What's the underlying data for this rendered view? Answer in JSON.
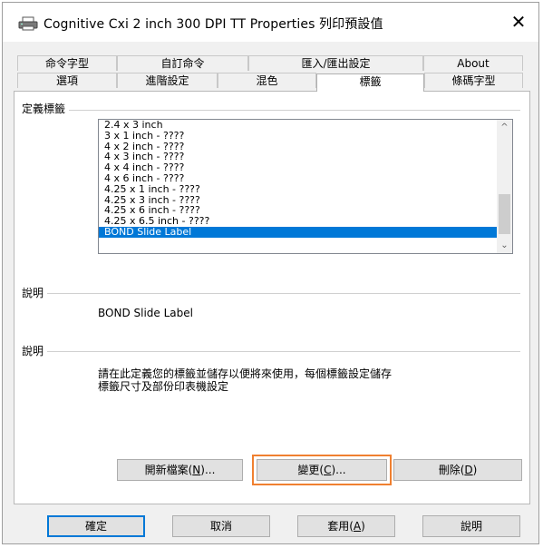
{
  "window": {
    "title": "Cognitive Cxi 2 inch 300 DPI TT Properties 列印預設值",
    "close_label": "✕"
  },
  "tabs": {
    "row1": [
      {
        "label": "命令字型"
      },
      {
        "label": "自訂命令"
      },
      {
        "label": "匯入/匯出設定"
      },
      {
        "label": "About"
      }
    ],
    "row2": [
      {
        "label": "選項"
      },
      {
        "label": "進階設定"
      },
      {
        "label": "混色"
      },
      {
        "label": "標籤",
        "active": true
      },
      {
        "label": "條碼字型"
      }
    ]
  },
  "define_label": {
    "group_title": "定義標籤",
    "items": [
      "2.4 x 3 inch",
      "3 x 1 inch - ????",
      "4 x 2 inch - ????",
      "4 x 3 inch - ????",
      "4 x 4 inch - ????",
      "4 x 6 inch - ????",
      "4.25 x 1 inch - ????",
      "4.25 x 3 inch - ????",
      "4.25 x 6 inch - ????",
      "4.25 x 6.5 inch - ????",
      "BOND Slide Label"
    ],
    "selected": "BOND Slide Label"
  },
  "description1": {
    "group_title": "說明",
    "text": "BOND Slide Label"
  },
  "description2": {
    "group_title": "說明",
    "line1": "請在此定義您的標籤並儲存以便將來使用，每個標籤設定儲存",
    "line2": "標籤尺寸及部份印表機設定"
  },
  "panel_buttons": {
    "new": {
      "text": "開新檔案(",
      "key": "N",
      "suffix": ")..."
    },
    "change": {
      "text": "變更(",
      "key": "C",
      "suffix": ")..."
    },
    "delete": {
      "text": "刪除(",
      "key": "D",
      "suffix": ")"
    }
  },
  "dialog_buttons": {
    "ok": "確定",
    "cancel": "取消",
    "apply": {
      "text": "套用(",
      "key": "A",
      "suffix": ")"
    },
    "help": "說明"
  },
  "colors": {
    "selection": "#0078d7",
    "focus_ring": "#f08030"
  }
}
